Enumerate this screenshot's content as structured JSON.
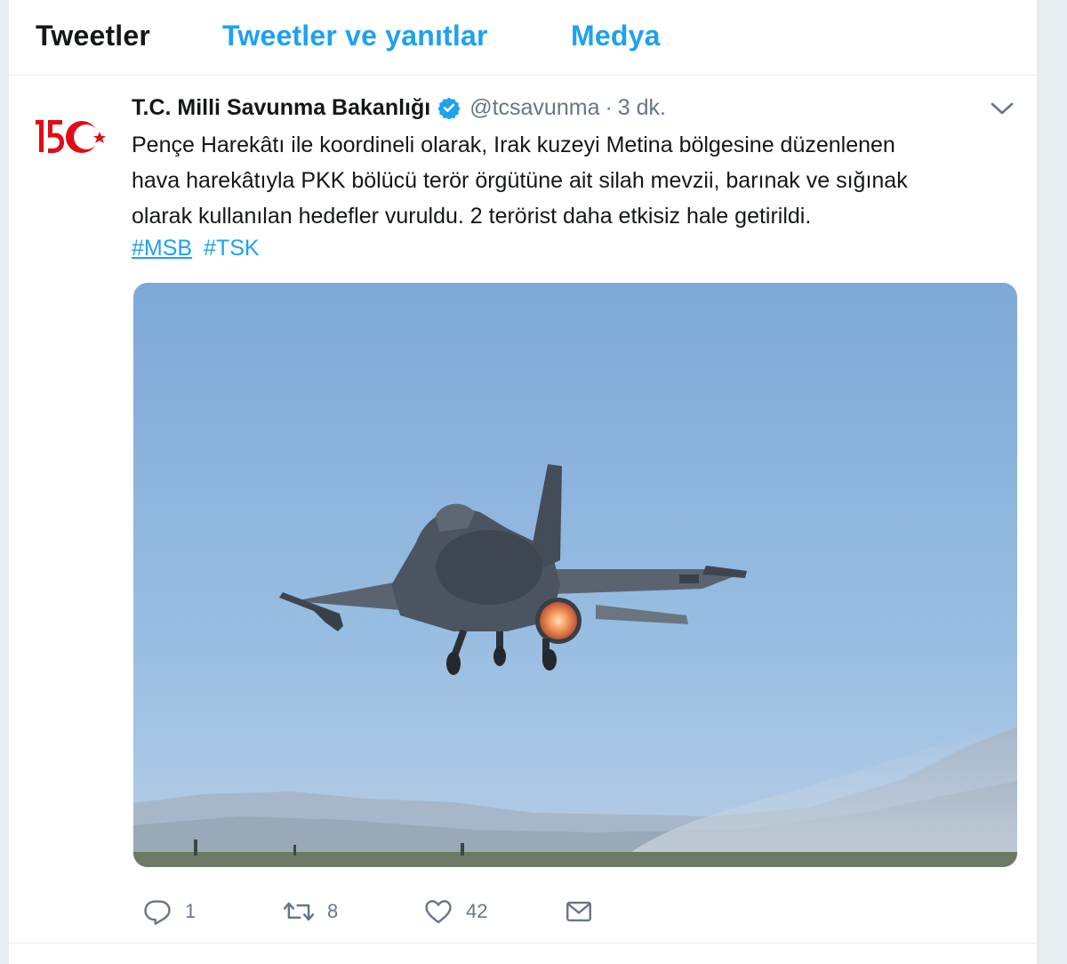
{
  "tabs": {
    "tweets": "Tweetler",
    "tweets_replies": "Tweetler ve yanıtlar",
    "media": "Medya"
  },
  "tweet": {
    "author_name": "T.C. Milli Savunma Bakanlığı",
    "handle": "@tcsavunma",
    "separator": "·",
    "time": "3 dk.",
    "text_lines": [
      "Pençe Harekâtı ile koordineli olarak, Irak kuzeyi Metina bölgesine düzenlenen",
      "hava harekâtıyla PKK bölücü terör örgütüne ait silah mevzii, barınak ve sığınak",
      "olarak kullanılan hedefler vuruldu. 2 terörist daha etkisiz hale getirildi."
    ],
    "hashtags": [
      "#MSB",
      "#TSK"
    ],
    "avatar_label": "150",
    "counts": {
      "replies": "1",
      "retweets": "8",
      "likes": "42"
    }
  },
  "icons": {
    "verified": "verified-badge-icon",
    "caret": "chevron-down-icon",
    "reply": "reply-icon",
    "retweet": "retweet-icon",
    "like": "heart-icon",
    "dm": "envelope-icon"
  },
  "colors": {
    "accent": "#1da1f2",
    "text": "#14171a",
    "secondary": "#657786",
    "logo_red": "#e30a17",
    "sky": "#8fb5de"
  }
}
